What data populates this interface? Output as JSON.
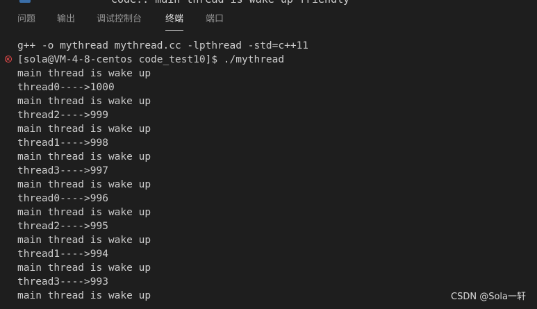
{
  "header_peek": "code.. main thread is wake up friendly",
  "tabs": [
    {
      "label": "问题"
    },
    {
      "label": "输出"
    },
    {
      "label": "调试控制台"
    },
    {
      "label": "终端",
      "active": true
    },
    {
      "label": "端口"
    }
  ],
  "terminal": {
    "lines": [
      {
        "text": "g++ -o mythread mythread.cc -lpthread -std=c++11"
      },
      {
        "text": "[sola@VM-4-8-centos code_test10]$ ./mythread",
        "status": "error"
      },
      {
        "text": "main thread is wake up"
      },
      {
        "text": "thread0---->1000"
      },
      {
        "text": "main thread is wake up"
      },
      {
        "text": "thread2---->999"
      },
      {
        "text": "main thread is wake up"
      },
      {
        "text": "thread1---->998"
      },
      {
        "text": "main thread is wake up"
      },
      {
        "text": "thread3---->997"
      },
      {
        "text": "main thread is wake up"
      },
      {
        "text": "thread0---->996"
      },
      {
        "text": "main thread is wake up"
      },
      {
        "text": "thread2---->995"
      },
      {
        "text": "main thread is wake up"
      },
      {
        "text": "thread1---->994"
      },
      {
        "text": "main thread is wake up"
      },
      {
        "text": "thread3---->993"
      },
      {
        "text": "main thread is wake up"
      }
    ]
  },
  "watermark": "CSDN @Sola一轩",
  "colors": {
    "background": "#1e1e1e",
    "text": "#cccccc",
    "error": "#f14c4c"
  }
}
